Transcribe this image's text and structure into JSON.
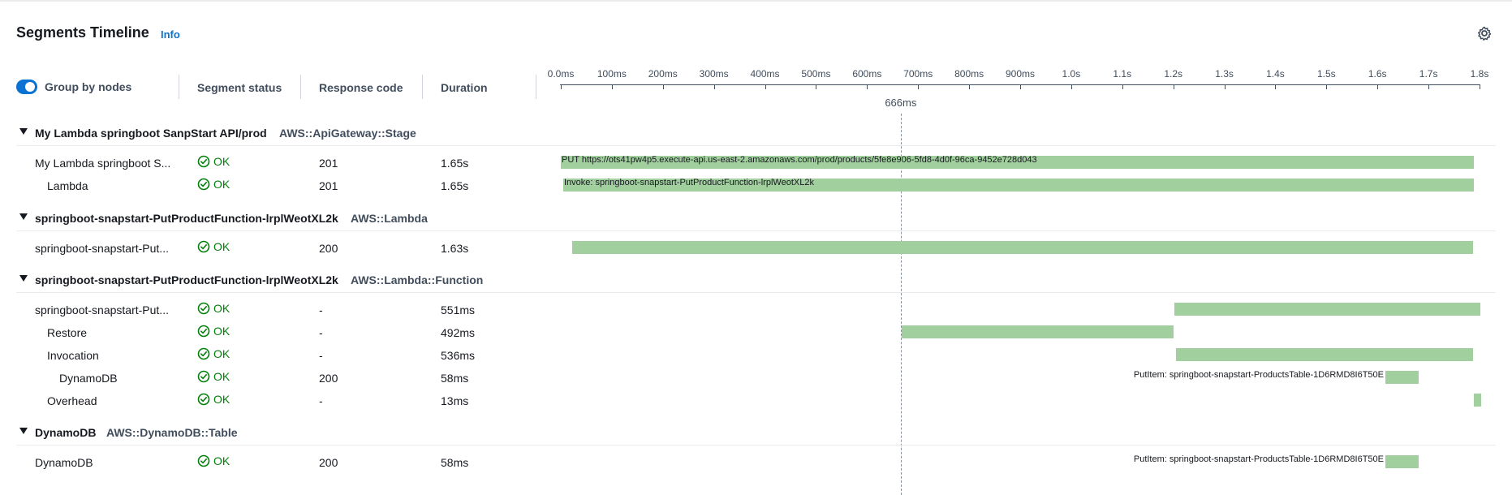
{
  "header": {
    "title": "Segments Timeline",
    "info_label": "Info",
    "settings_icon": "gear-icon"
  },
  "columns": {
    "group_by_nodes": "Group by nodes",
    "group_by_nodes_enabled": true,
    "segment_status": "Segment status",
    "response_code": "Response code",
    "duration": "Duration"
  },
  "timeline": {
    "ticks": [
      "0.0ms",
      "100ms",
      "200ms",
      "300ms",
      "400ms",
      "500ms",
      "600ms",
      "700ms",
      "800ms",
      "900ms",
      "1.0s",
      "1.1s",
      "1.2s",
      "1.3s",
      "1.4s",
      "1.5s",
      "1.6s",
      "1.7s",
      "1.8s"
    ],
    "cursor_label": "666ms",
    "cursor_ms": 666
  },
  "groups": [
    {
      "name": "My Lambda springboot SanpStart API/prod",
      "type": "AWS::ApiGateway::Stage",
      "rows": [
        {
          "name": "My Lambda springboot S...",
          "status": "OK",
          "code": "201",
          "duration": "1.65s",
          "bar_label": "PUT https://ots41pw4p5.execute-api.us-east-2.amazonaws.com/prod/products/5fe8e906-5fd8-4d0f-96ca-9452e728d043"
        },
        {
          "name": "Lambda",
          "status": "OK",
          "code": "201",
          "duration": "1.65s",
          "bar_label": "Invoke: springboot-snapstart-PutProductFunction-lrplWeotXL2k"
        }
      ]
    },
    {
      "name": "springboot-snapstart-PutProductFunction-lrplWeotXL2k",
      "type": "AWS::Lambda",
      "rows": [
        {
          "name": "springboot-snapstart-Put...",
          "status": "OK",
          "code": "200",
          "duration": "1.63s",
          "bar_label": ""
        }
      ]
    },
    {
      "name": "springboot-snapstart-PutProductFunction-lrplWeotXL2k",
      "type": "AWS::Lambda::Function",
      "rows": [
        {
          "name": "springboot-snapstart-Put...",
          "status": "OK",
          "code": "-",
          "duration": "551ms",
          "bar_label": ""
        },
        {
          "name": "Restore",
          "status": "OK",
          "code": "-",
          "duration": "492ms",
          "bar_label": ""
        },
        {
          "name": "Invocation",
          "status": "OK",
          "code": "-",
          "duration": "536ms",
          "bar_label": ""
        },
        {
          "name": "DynamoDB",
          "status": "OK",
          "code": "200",
          "duration": "58ms",
          "bar_label": "PutItem: springboot-snapstart-ProductsTable-1D6RMD8I6T50E"
        },
        {
          "name": "Overhead",
          "status": "OK",
          "code": "-",
          "duration": "13ms",
          "bar_label": ""
        }
      ]
    },
    {
      "name": "DynamoDB",
      "type": "AWS::DynamoDB::Table",
      "rows": [
        {
          "name": "DynamoDB",
          "status": "OK",
          "code": "200",
          "duration": "58ms",
          "bar_label": "PutItem: springboot-snapstart-ProductsTable-1D6RMD8I6T50E"
        }
      ]
    }
  ]
}
